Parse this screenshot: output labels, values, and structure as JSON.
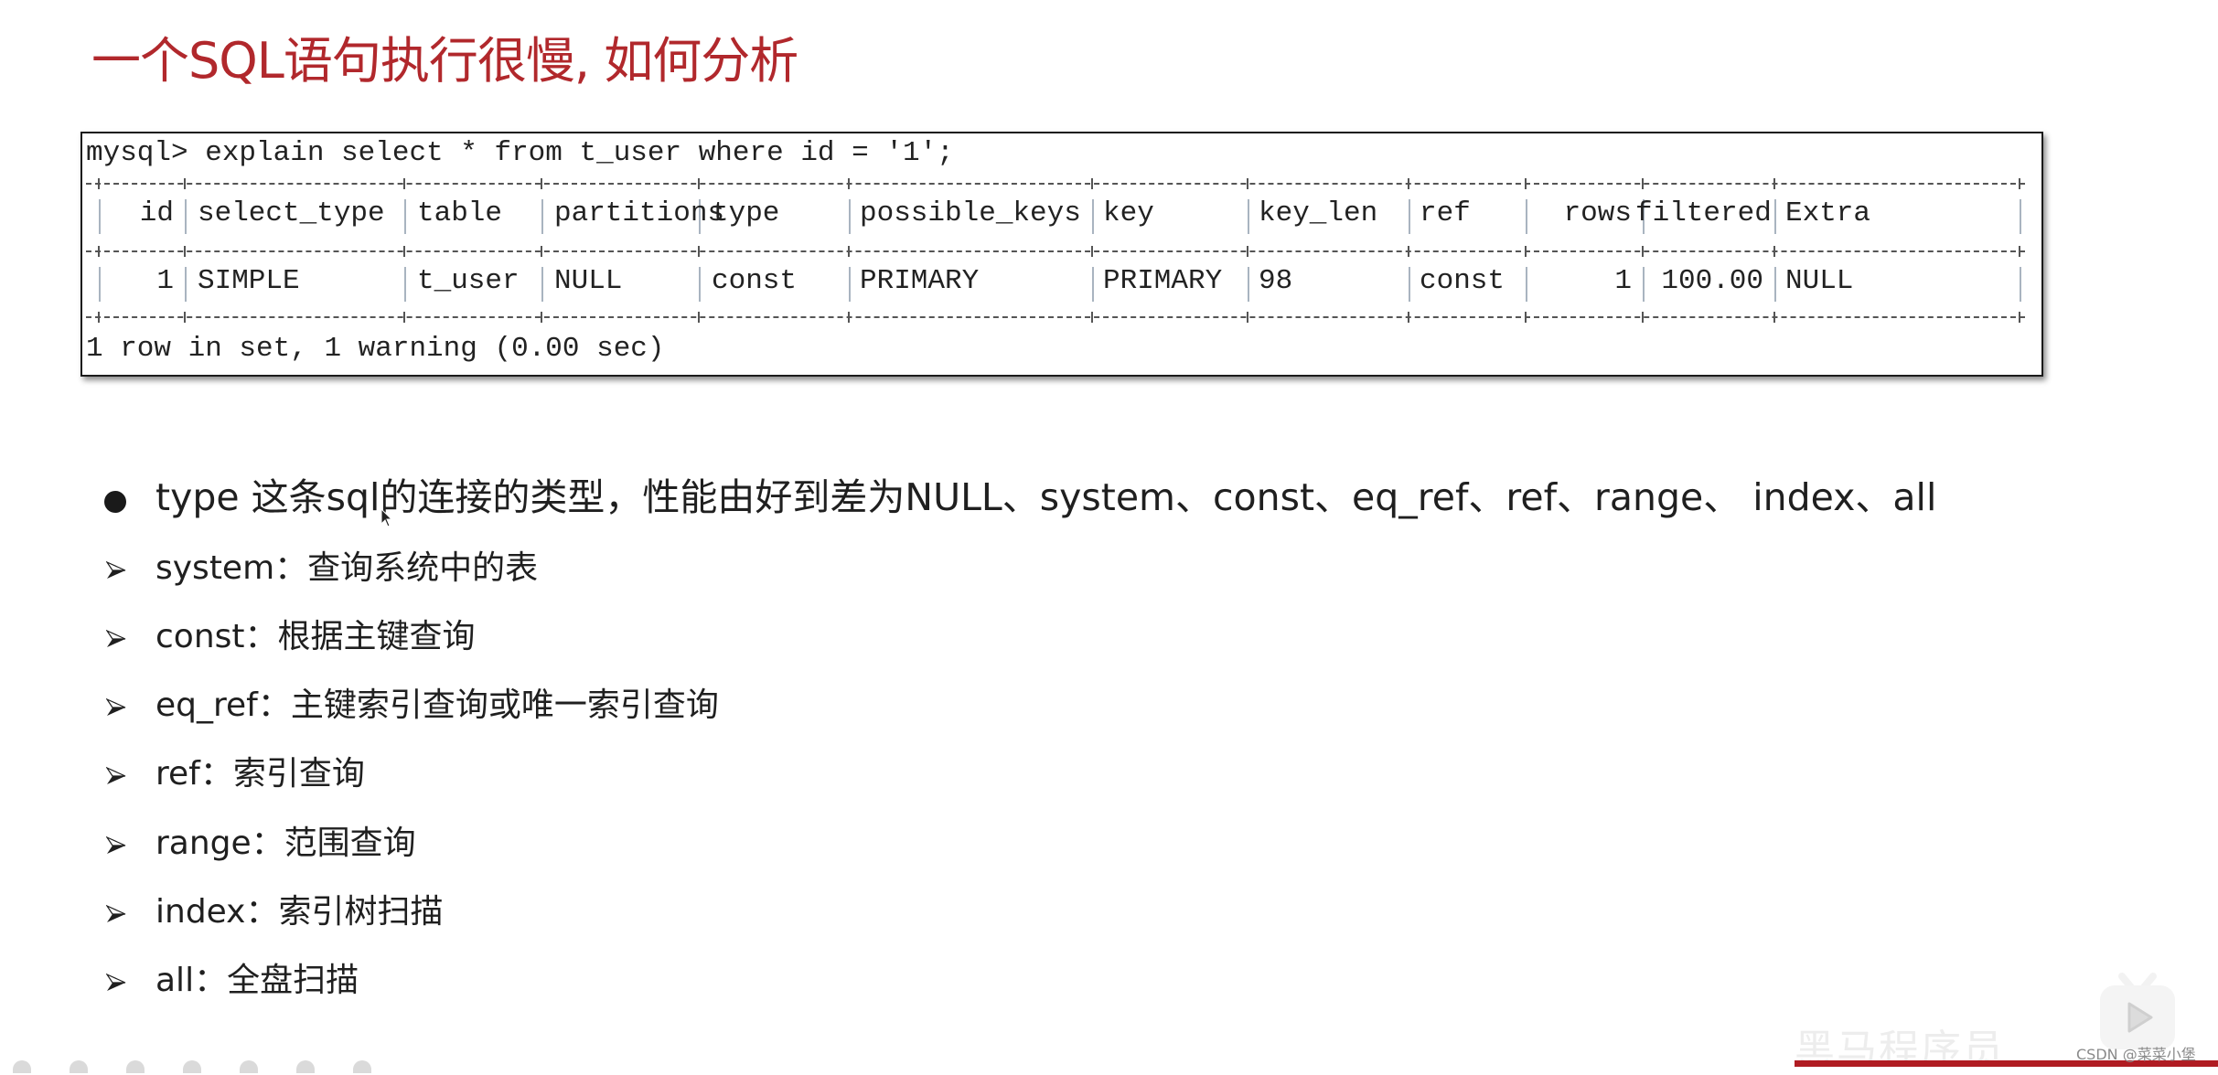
{
  "slide": {
    "title": "一个SQL语句执行很慢, 如何分析"
  },
  "terminal": {
    "command": "mysql> explain select * from t_user where id = '1';",
    "columns": [
      "id",
      "select_type",
      "table",
      "partitions",
      "type",
      "possible_keys",
      "key",
      "key_len",
      "ref",
      "rows",
      "filtered",
      "Extra"
    ],
    "rows": [
      [
        "1",
        "SIMPLE",
        "t_user",
        "NULL",
        "const",
        "PRIMARY",
        "PRIMARY",
        "98",
        "const",
        "1",
        "100.00",
        "NULL"
      ]
    ],
    "summary": "1 row in set, 1 warning (0.00 sec)"
  },
  "notes": {
    "main": "type 这条sql的连接的类型，性能由好到差为NULL、system、const、eq_ref、ref、range、 index、all",
    "items": [
      "system：查询系统中的表",
      "const：根据主键查询",
      "eq_ref：主键索引查询或唯一索引查询",
      "ref：索引查询",
      "range：范围查询",
      "index：索引树扫描",
      "all：全盘扫描"
    ]
  },
  "watermark": {
    "brand_text": "黑马程序员",
    "credit": "CSDN @菜菜小堡",
    "icon": "bilibili-tv-icon"
  },
  "colors": {
    "title": "#b1282c",
    "brand_red": "#b01c22"
  }
}
